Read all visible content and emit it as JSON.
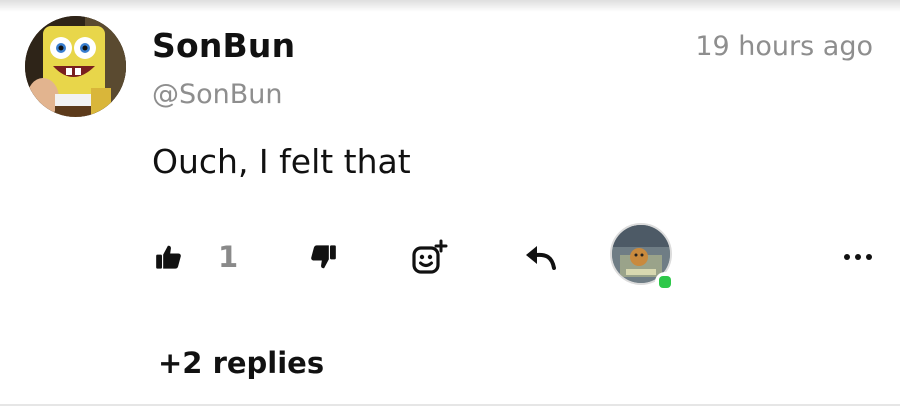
{
  "comment": {
    "username": "SonBun",
    "handle": "@SonBun",
    "timestamp": "19 hours ago",
    "text": "Ouch, I felt that",
    "like_count": "1",
    "replies_label": "+2 replies"
  },
  "icons": {
    "like": "thumbs-up-icon",
    "dislike": "thumbs-down-icon",
    "react": "add-reaction-icon",
    "reply": "reply-icon",
    "more": "more-horizontal-icon"
  },
  "colors": {
    "text_primary": "#111111",
    "text_secondary": "#8e8e8e",
    "online_status": "#2ec84a"
  }
}
